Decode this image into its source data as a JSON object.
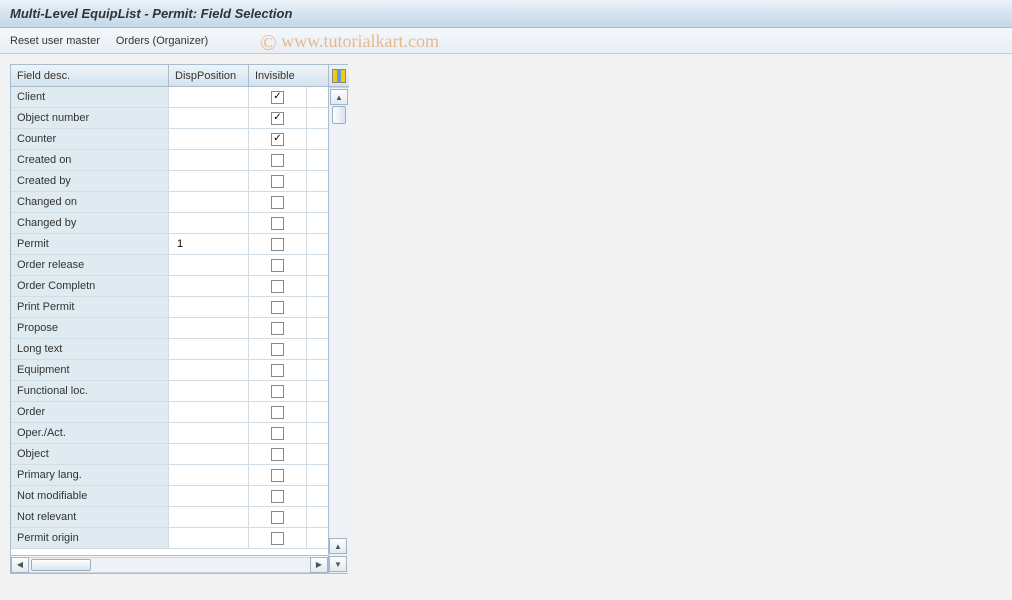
{
  "title": "Multi-Level EquipList - Permit: Field Selection",
  "toolbar": {
    "reset_label": "Reset user master",
    "orders_label": "Orders (Organizer)"
  },
  "watermark": "www.tutorialkart.com",
  "table": {
    "columns": {
      "field_desc": "Field desc.",
      "disp_position": "DispPosition",
      "invisible": "Invisible"
    },
    "rows": [
      {
        "label": "Client",
        "disp": "",
        "invisible": true
      },
      {
        "label": "Object number",
        "disp": "",
        "invisible": true
      },
      {
        "label": "Counter",
        "disp": "",
        "invisible": true
      },
      {
        "label": "Created on",
        "disp": "",
        "invisible": false
      },
      {
        "label": "Created by",
        "disp": "",
        "invisible": false
      },
      {
        "label": "Changed on",
        "disp": "",
        "invisible": false
      },
      {
        "label": "Changed by",
        "disp": "",
        "invisible": false
      },
      {
        "label": "Permit",
        "disp": "1",
        "invisible": false
      },
      {
        "label": "Order release",
        "disp": "",
        "invisible": false
      },
      {
        "label": "Order Completn",
        "disp": "",
        "invisible": false
      },
      {
        "label": "Print Permit",
        "disp": "",
        "invisible": false
      },
      {
        "label": "Propose",
        "disp": "",
        "invisible": false
      },
      {
        "label": "Long text",
        "disp": "",
        "invisible": false
      },
      {
        "label": "Equipment",
        "disp": "",
        "invisible": false
      },
      {
        "label": "Functional loc.",
        "disp": "",
        "invisible": false
      },
      {
        "label": "Order",
        "disp": "",
        "invisible": false
      },
      {
        "label": "Oper./Act.",
        "disp": "",
        "invisible": false
      },
      {
        "label": "Object",
        "disp": "",
        "invisible": false
      },
      {
        "label": "Primary lang.",
        "disp": "",
        "invisible": false
      },
      {
        "label": "Not modifiable",
        "disp": "",
        "invisible": false
      },
      {
        "label": "Not relevant",
        "disp": "",
        "invisible": false
      },
      {
        "label": "Permit origin",
        "disp": "",
        "invisible": false
      }
    ]
  }
}
